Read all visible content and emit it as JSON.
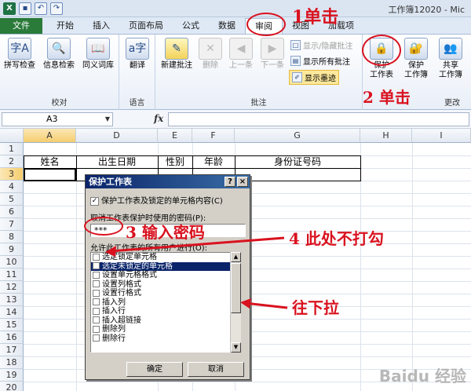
{
  "window": {
    "title": "工作簿12020 - Mic",
    "qat": {
      "app_icon": "X",
      "save_icon": "save-icon",
      "undo_icon": "undo-icon",
      "redo_icon": "redo-icon"
    }
  },
  "tabs": [
    "文件",
    "开始",
    "插入",
    "页面布局",
    "公式",
    "数据",
    "审阅",
    "视图",
    "加载项"
  ],
  "ribbon": {
    "proofing": {
      "label": "校对",
      "buttons": [
        "拼写检查",
        "信息检索",
        "同义词库"
      ]
    },
    "language": {
      "label": "语言",
      "buttons": [
        "翻译"
      ]
    },
    "comments": {
      "label": "批注",
      "buttons": [
        "新建批注",
        "删除",
        "上一条",
        "下一条"
      ],
      "small": [
        "显示/隐藏批注",
        "显示所有批注",
        "显示墨迹"
      ]
    },
    "changes": {
      "label": "更改",
      "buttons": [
        {
          "line1": "保护",
          "line2": "工作表"
        },
        {
          "line1": "保护",
          "line2": "工作簿"
        },
        {
          "line1": "共享",
          "line2": "工作簿"
        }
      ]
    }
  },
  "formula_bar": {
    "name_box": "A3",
    "fx": "fx",
    "value": ""
  },
  "grid": {
    "columns": [
      "A",
      "D",
      "E",
      "F",
      "G",
      "H",
      "I"
    ],
    "rows": [
      "1",
      "2",
      "3",
      "4",
      "5",
      "6",
      "7",
      "8",
      "9",
      "10",
      "11",
      "12",
      "13",
      "14",
      "15",
      "16",
      "17",
      "18",
      "19",
      "20"
    ],
    "headers": [
      "姓名",
      "出生日期",
      "性别",
      "年龄",
      "身份证号码"
    ]
  },
  "dialog": {
    "title": "保护工作表",
    "help": "?",
    "close": "×",
    "protect_label": "保护工作表及锁定的单元格内容(C)",
    "protect_checked": true,
    "password_label": "取消工作表保护时使用的密码(P):",
    "password_value": "***",
    "permissions_label": "允许此工作表的所有用户进行(O):",
    "permissions": [
      {
        "label": "选定锁定单元格",
        "checked": false
      },
      {
        "label": "选定未锁定的单元格",
        "checked": true
      },
      {
        "label": "设置单元格格式",
        "checked": false
      },
      {
        "label": "设置列格式",
        "checked": false
      },
      {
        "label": "设置行格式",
        "checked": false
      },
      {
        "label": "插入列",
        "checked": false
      },
      {
        "label": "插入行",
        "checked": false
      },
      {
        "label": "插入超链接",
        "checked": false
      },
      {
        "label": "删除列",
        "checked": false
      },
      {
        "label": "删除行",
        "checked": false
      }
    ],
    "ok": "确定",
    "cancel": "取消"
  },
  "annotations": {
    "step1": "1单击",
    "step2": "2 单击",
    "step3": "3 输入密码",
    "step4": "4 此处不打勾",
    "scroll_hint": "往下拉",
    "color": "#d9121f"
  },
  "watermark": "Baidu 经验"
}
